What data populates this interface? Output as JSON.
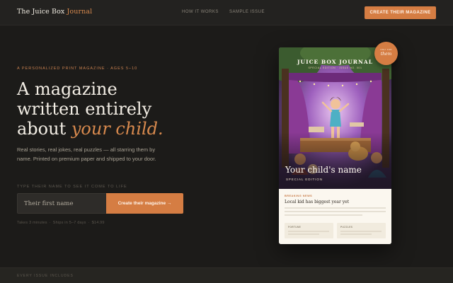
{
  "nav": {
    "logo_main": "The Juice Box",
    "logo_accent": "Journal",
    "links": [
      "How it works",
      "Sample issue"
    ],
    "cta": "Create their magazine"
  },
  "hero": {
    "eyebrow": "A personalized print magazine · Ages 5–10",
    "headline_line1": "A magazine",
    "headline_line2": "written entirely",
    "headline_line3_prefix": "about ",
    "headline_line3_emphasis": "your child.",
    "subcopy": "Real stories, real jokes, real puzzles — all starring them by name. Printed on premium paper and shipped to your door.",
    "field_label": "Type their name to see it come to life",
    "input_value": "",
    "input_placeholder": "Their first name",
    "submit_label": "Create their magazine →",
    "fineprint": [
      "Takes 3 minutes",
      "Ships in 5–7 days",
      "$14.99"
    ]
  },
  "magazine": {
    "title": "JUICE BOX JOURNAL",
    "issue_line": "Special Edition · Issue No. 001",
    "cover_name": "Your child's name",
    "cover_edition": "Special Edition",
    "inside_kicker": "Breaking News",
    "inside_headline": "Local kid has biggest year yet",
    "cards": [
      "Fortune",
      "Puzzles"
    ]
  },
  "badge": {
    "top": "Only for",
    "main": "them"
  },
  "strip": {
    "label": "Every issue includes"
  },
  "colors": {
    "background": "#1c1b19",
    "accent": "#d57d43",
    "accent_text": "#d98a4e",
    "paper": "#fbf7ef"
  }
}
